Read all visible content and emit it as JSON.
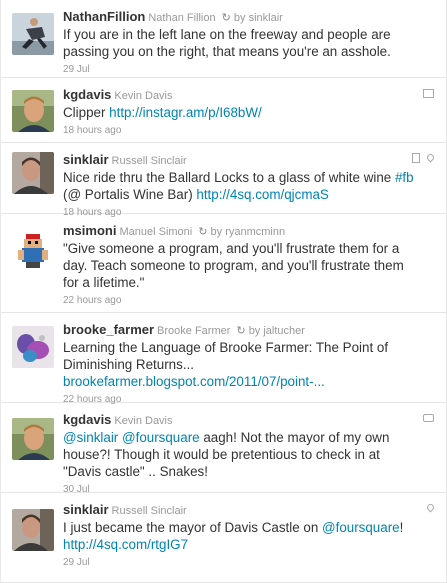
{
  "tweets": [
    {
      "username": "NathanFillion",
      "fullname": "Nathan Fillion",
      "retweet_icon": "↻",
      "retweeted_by": "by sinklair",
      "text": [
        {
          "t": "If you are in the left lane on the freeway and people are passing you on the right, that means you're an asshole."
        }
      ],
      "time": "29 Jul",
      "avatar": "nathan-fillion-avatar",
      "actions": []
    },
    {
      "username": "kgdavis",
      "fullname": "Kevin Davis",
      "text": [
        {
          "t": "Clipper "
        },
        {
          "t": "http://instagr.am/p/I68bW/",
          "link": true
        }
      ],
      "time": "18 hours ago",
      "avatar": "kevin-davis-avatar",
      "actions": [
        "media"
      ]
    },
    {
      "username": "sinklair",
      "fullname": "Russell Sinclair",
      "text": [
        {
          "t": "Nice ride thru the Ballard Locks to a glass of white wine "
        },
        {
          "t": "#fb",
          "link": true
        },
        {
          "t": " (@ Portalis Wine Bar) "
        },
        {
          "t": "http://4sq.com/qjcmaS",
          "link": true
        }
      ],
      "time": "18 hours ago",
      "avatar": "russell-sinclair-avatar",
      "actions": [
        "doc",
        "pin"
      ]
    },
    {
      "username": "msimoni",
      "fullname": "Manuel Simoni",
      "retweet_icon": "↻",
      "retweeted_by": "by ryanmcminn",
      "text": [
        {
          "t": "\"Give someone a program, and you'll frustrate them for a day. Teach someone to program, and you'll frustrate them for a lifetime.\""
        }
      ],
      "time": "22 hours ago",
      "avatar": "manuel-simoni-avatar",
      "actions": []
    },
    {
      "username": "brooke_farmer",
      "fullname": "Brooke Farmer",
      "retweet_icon": "↻",
      "retweeted_by": "by jaltucher",
      "text": [
        {
          "t": "Learning the Language of Brooke Farmer: The Point of Diminishing Returns... "
        },
        {
          "t": "brookefarmer.blogspot.com/2011/07/point-...",
          "link": true
        }
      ],
      "time": "22 hours ago",
      "avatar": "brooke-farmer-avatar",
      "actions": []
    },
    {
      "username": "kgdavis",
      "fullname": "Kevin Davis",
      "text": [
        {
          "t": "@sinklair",
          "link": true
        },
        {
          "t": " "
        },
        {
          "t": "@foursquare",
          "link": true
        },
        {
          "t": " aagh! Not the mayor of my own house?! Though it would be pretentious to check in at \"Davis castle\" .. Snakes!"
        }
      ],
      "time": "30 Jul",
      "avatar": "kevin-davis-avatar",
      "actions": [
        "reply"
      ]
    },
    {
      "username": "sinklair",
      "fullname": "Russell Sinclair",
      "text": [
        {
          "t": "I just became the mayor of Davis Castle on "
        },
        {
          "t": "@foursquare",
          "link": true
        },
        {
          "t": "! "
        },
        {
          "t": "http://4sq.com/rtgIG7",
          "link": true
        }
      ],
      "time": "29 Jul",
      "avatar": "russell-sinclair-avatar",
      "actions": [
        "pin"
      ]
    }
  ]
}
